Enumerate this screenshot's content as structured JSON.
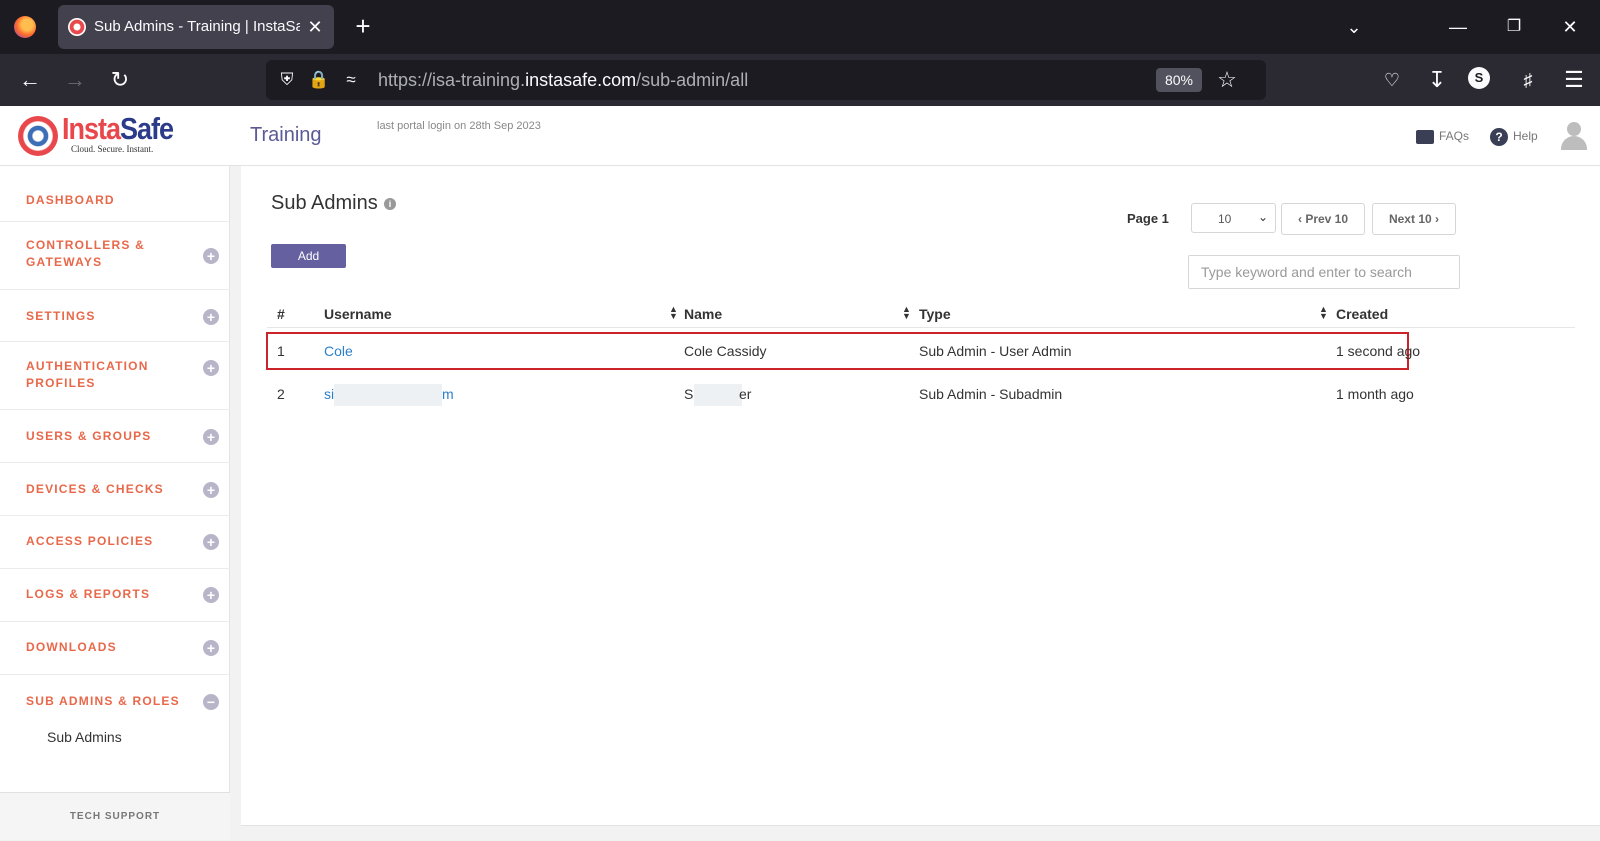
{
  "browser": {
    "tab_title": "Sub Admins - Training | InstaSafe",
    "tab_close": "✕",
    "new_tab": "+",
    "url_prefix": "https://isa-training.",
    "url_host": "instasafe.com",
    "url_path": "/sub-admin/all",
    "zoom": "80%",
    "profile_initial": "S",
    "icons": [
      "back-icon",
      "forward-icon",
      "reload-icon",
      "shield-icon",
      "lock-icon",
      "permissions-icon",
      "star-icon",
      "pocket-icon",
      "download-icon",
      "extensions-icon",
      "menu-icon"
    ]
  },
  "header": {
    "logo_text_a": "Insta",
    "logo_text_b": "Safe",
    "logo_tagline": "Cloud. Secure. Instant.",
    "portal_name": "Training",
    "last_login": "last portal login on 28th Sep 2023",
    "faqs": "FAQs",
    "help": "Help",
    "help_glyph": "?"
  },
  "sidebar": {
    "items": [
      {
        "label": "DASHBOARD",
        "toggle": ""
      },
      {
        "label": "CONTROLLERS & GATEWAYS",
        "toggle": "+"
      },
      {
        "label": "SETTINGS",
        "toggle": "+"
      },
      {
        "label": "AUTHENTICATION PROFILES",
        "toggle": "+"
      },
      {
        "label": "USERS & GROUPS",
        "toggle": "+"
      },
      {
        "label": "DEVICES & CHECKS",
        "toggle": "+"
      },
      {
        "label": "ACCESS POLICIES",
        "toggle": "+"
      },
      {
        "label": "LOGS & REPORTS",
        "toggle": "+"
      },
      {
        "label": "DOWNLOADS",
        "toggle": "+"
      },
      {
        "label": "SUB ADMINS & ROLES",
        "toggle": "−"
      }
    ],
    "sub_item": "Sub Admins",
    "tech_support": "TECH SUPPORT"
  },
  "main": {
    "title": "Sub Admins",
    "info_glyph": "i",
    "add_label": "Add",
    "page_label": "Page 1",
    "page_size": "10",
    "prev_label": "Prev 10",
    "next_label": "Next 10",
    "search_placeholder": "Type keyword and enter to search",
    "columns": [
      "#",
      "Username",
      "Name",
      "Type",
      "Created"
    ],
    "rows": [
      {
        "num": "1",
        "username": "Cole",
        "name": "Cole Cassidy",
        "type": "Sub Admin - User Admin",
        "created": "1 second ago"
      },
      {
        "num": "2",
        "username_start": "si",
        "username_end": "m",
        "name_start": "S",
        "name_end": "er",
        "type": "Sub Admin - Subadmin",
        "created": "1 month ago"
      }
    ]
  },
  "colors": {
    "accent": "#6560a0",
    "sidebar_label": "#e8684a",
    "link": "#2c7fc9",
    "highlight": "#cc2229"
  }
}
